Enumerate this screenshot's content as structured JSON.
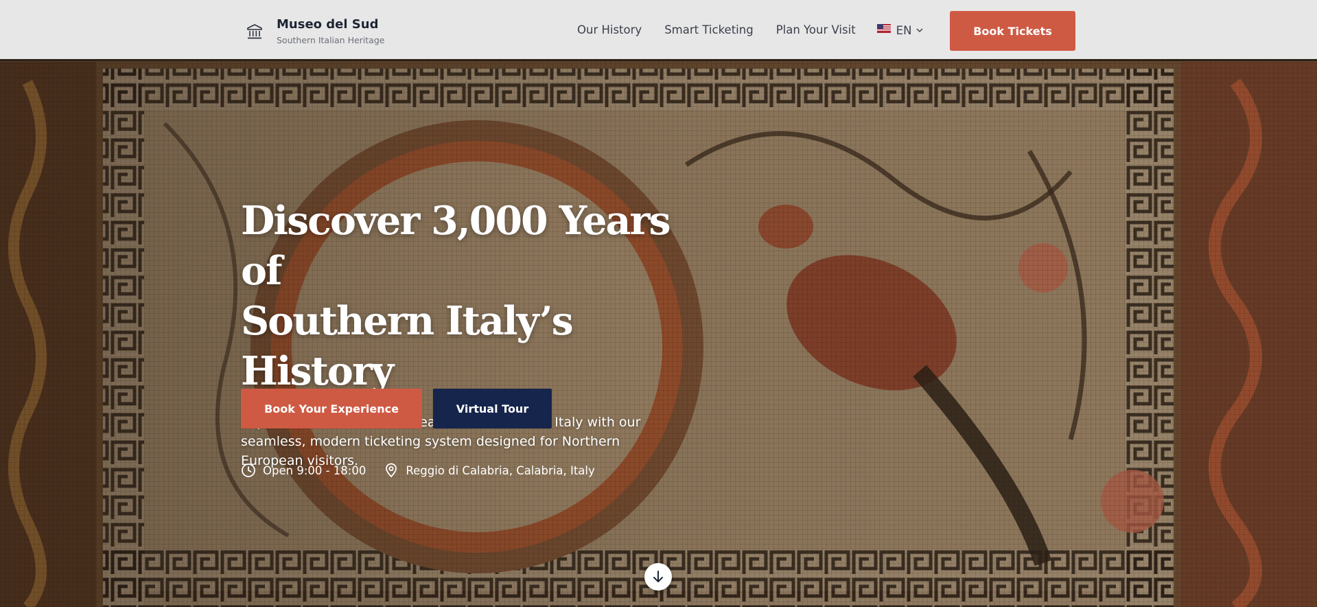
{
  "brand": {
    "name": "Museo del Sud",
    "tagline": "Southern Italian Heritage",
    "icon": "museum-icon"
  },
  "nav": {
    "links": [
      "Our History",
      "Smart Ticketing",
      "Plan Your Visit"
    ],
    "language": "EN",
    "book_label": "Book Tickets"
  },
  "hero": {
    "title_line1": "Discover 3,000 Years of",
    "title_line2": "Southern Italy’s History",
    "subtitle": "Experience the authentic treasures of Southern Italy with our seamless, modern ticketing system designed for Northern European visitors.",
    "primary_cta": "Book Your Experience",
    "secondary_cta": "Virtual Tour",
    "hours": "Open 9:00 - 18:00",
    "location": "Reggio di Calabria, Calabria, Italy"
  },
  "colors": {
    "accent": "#cf5a44",
    "navy": "#16254b",
    "nav_bg": "#e7e7e7"
  }
}
